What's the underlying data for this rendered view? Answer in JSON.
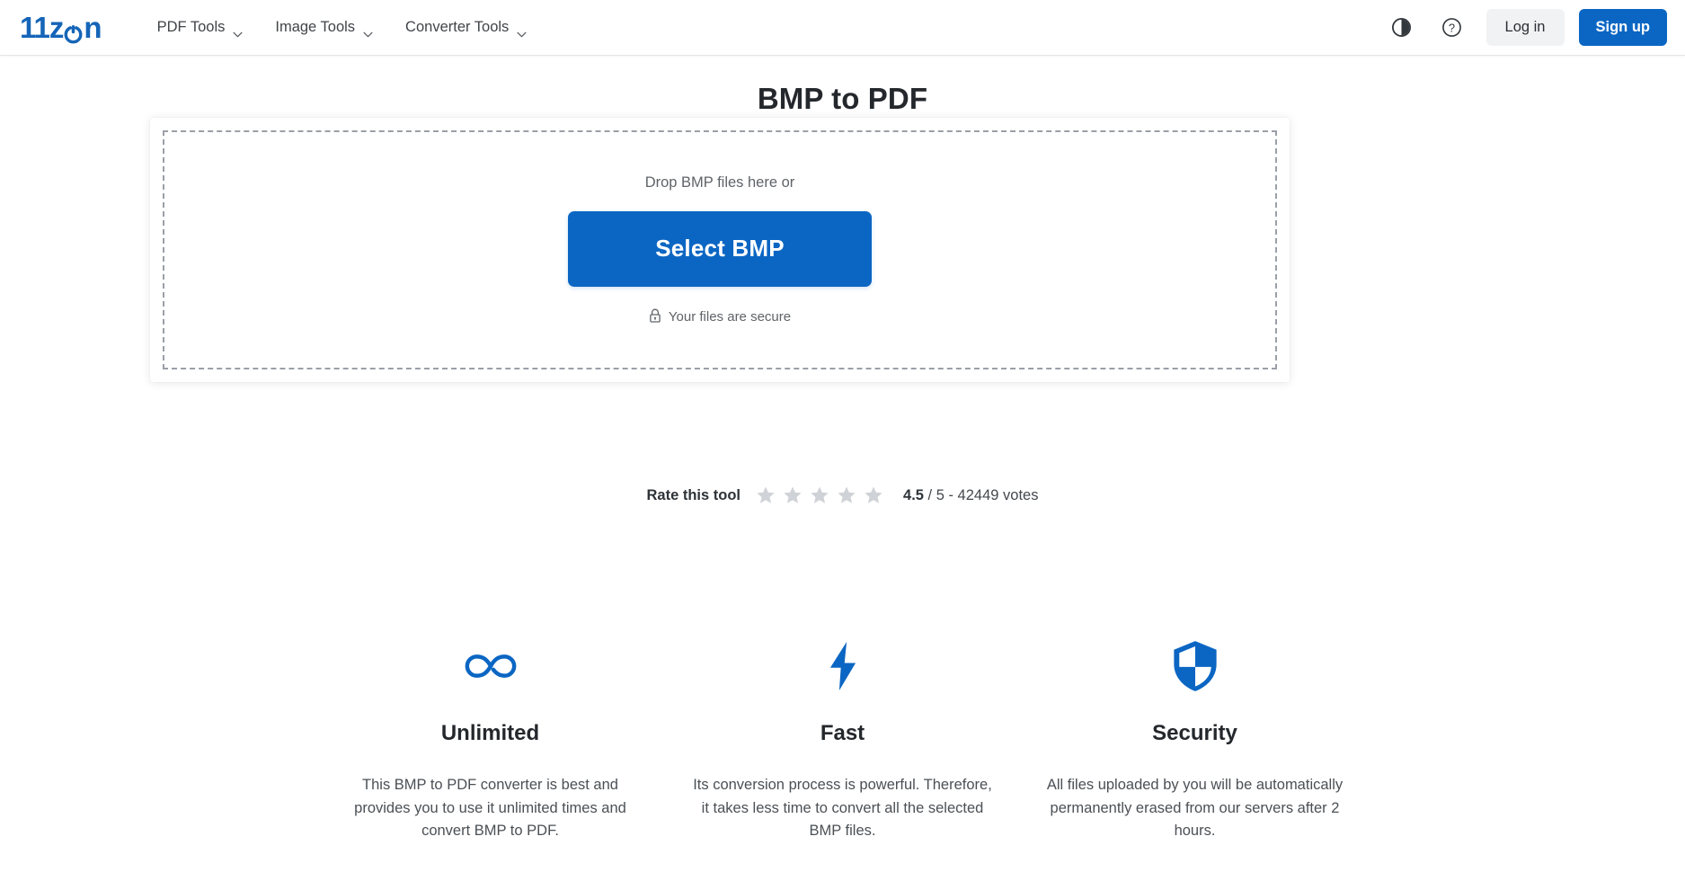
{
  "header": {
    "logo": {
      "text_before": "11z",
      "icon": "power-icon",
      "text_after": "n",
      "full": "11zon",
      "color": "#1565b8"
    },
    "nav": [
      {
        "label": "PDF Tools",
        "icon": "chevron-down-icon"
      },
      {
        "label": "Image Tools",
        "icon": "chevron-down-icon"
      },
      {
        "label": "Converter Tools",
        "icon": "chevron-down-icon"
      }
    ],
    "theme_toggle_icon": "contrast-icon",
    "help_icon": "question-circle-icon",
    "login_label": "Log in",
    "signup_label": "Sign up"
  },
  "main": {
    "title": "BMP to PDF",
    "dropzone": {
      "drop_text": "Drop BMP files here or",
      "select_button_label": "Select BMP",
      "secure_icon": "lock-icon",
      "secure_text": "Your files are secure"
    }
  },
  "rating": {
    "label": "Rate this tool",
    "stars_total": 5,
    "star_icon": "star-icon",
    "score": "4.5",
    "out_of": " / 5 - 42449 votes"
  },
  "features": [
    {
      "icon": "infinity-icon",
      "title": "Unlimited",
      "description": "This BMP to PDF converter is best and provides you to use it unlimited times and convert BMP to PDF."
    },
    {
      "icon": "lightning-bolt-icon",
      "title": "Fast",
      "description": "Its conversion process is powerful. Therefore, it takes less time to convert all the selected BMP files."
    },
    {
      "icon": "shield-icon",
      "title": "Security",
      "description": "All files uploaded by you will be automatically permanently erased from our servers after 2 hours."
    }
  ],
  "colors": {
    "brand_blue": "#0b66c3",
    "logo_blue": "#1565b8",
    "star_gray": "#cfd2d6",
    "dash_gray": "#9ba0a6"
  }
}
